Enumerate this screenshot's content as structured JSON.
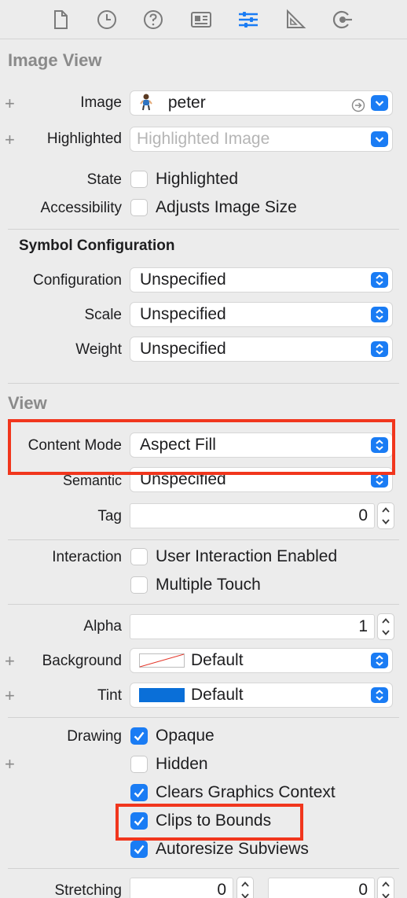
{
  "tabs": [
    {
      "icon": "file-icon"
    },
    {
      "icon": "clock-icon"
    },
    {
      "icon": "help-icon"
    },
    {
      "icon": "identity-icon"
    },
    {
      "icon": "attributes-icon",
      "selected": true
    },
    {
      "icon": "ruler-icon"
    },
    {
      "icon": "connections-icon"
    }
  ],
  "image_view": {
    "title": "Image View",
    "image_label": "Image",
    "image_value": "peter",
    "highlighted_label": "Highlighted",
    "highlighted_placeholder": "Highlighted Image",
    "state_label": "State",
    "state_option": "Highlighted",
    "accessibility_label": "Accessibility",
    "accessibility_option": "Adjusts Image Size"
  },
  "symbol_config": {
    "title": "Symbol Configuration",
    "configuration_label": "Configuration",
    "configuration_value": "Unspecified",
    "scale_label": "Scale",
    "scale_value": "Unspecified",
    "weight_label": "Weight",
    "weight_value": "Unspecified"
  },
  "view": {
    "title": "View",
    "content_mode_label": "Content Mode",
    "content_mode_value": "Aspect Fill",
    "semantic_label": "Semantic",
    "semantic_value": "Unspecified",
    "tag_label": "Tag",
    "tag_value": "0",
    "interaction_label": "Interaction",
    "user_interaction_label": "User Interaction Enabled",
    "multiple_touch_label": "Multiple Touch",
    "alpha_label": "Alpha",
    "alpha_value": "1",
    "background_label": "Background",
    "background_value": "Default",
    "tint_label": "Tint",
    "tint_value": "Default",
    "tint_color": "#0a6fd8",
    "drawing_label": "Drawing",
    "opaque_label": "Opaque",
    "hidden_label": "Hidden",
    "clears_label": "Clears Graphics Context",
    "clips_label": "Clips to Bounds",
    "autoresize_label": "Autoresize Subviews",
    "stretching_label": "Stretching",
    "stretch_x": "0",
    "stretch_y": "0"
  },
  "accent_color": "#1a7cf4",
  "annotation_color": "#f1361d"
}
